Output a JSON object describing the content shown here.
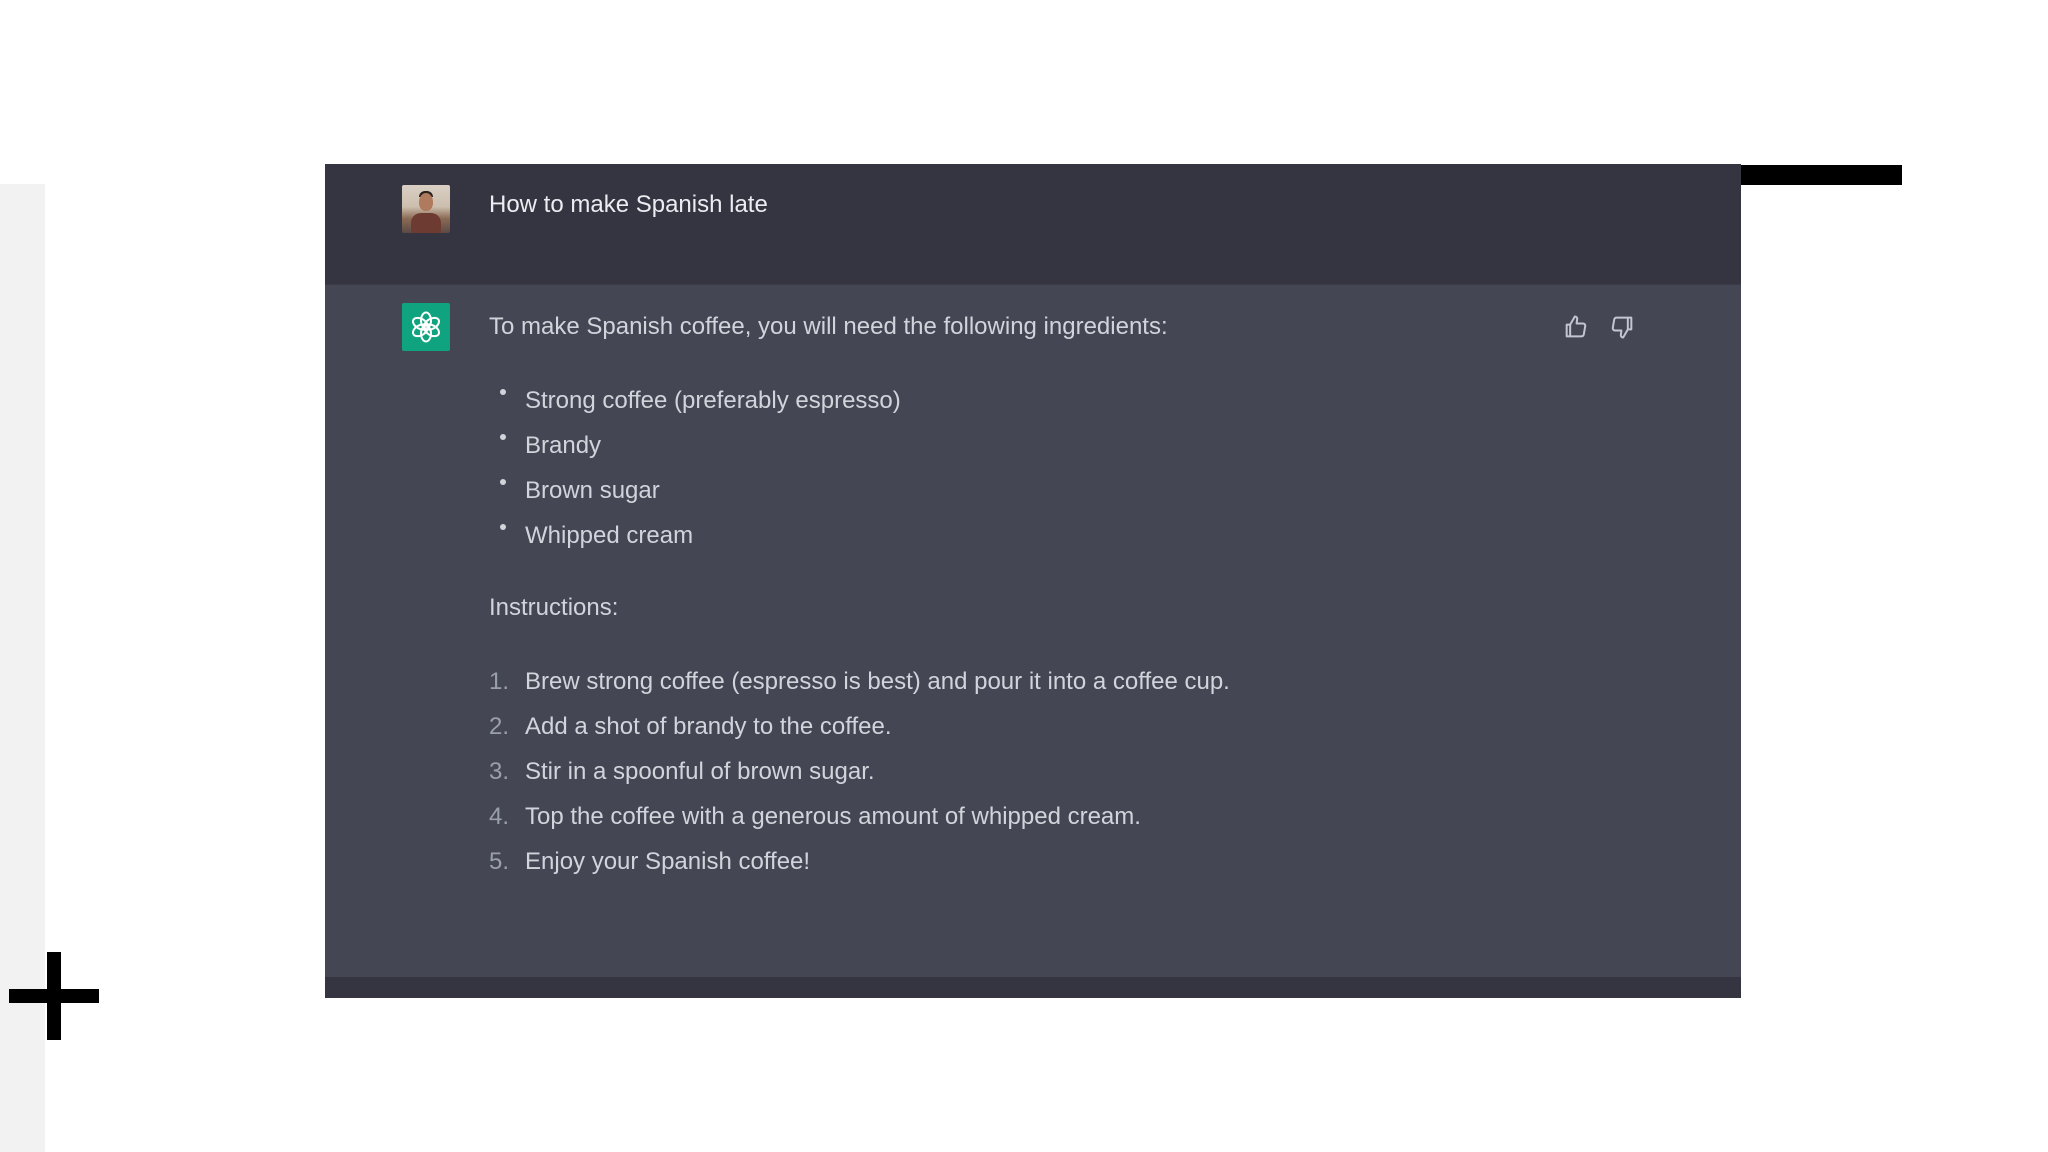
{
  "colors": {
    "page_background": "#ffffff",
    "user_row_background": "#343541",
    "assistant_row_background": "#444654",
    "assistant_avatar": "#10a37f",
    "text": "#d1d5db"
  },
  "conversation": {
    "user_message": "How to make Spanish late",
    "assistant": {
      "intro": "To make Spanish coffee, you will need the following ingredients:",
      "ingredients": [
        "Strong coffee (preferably espresso)",
        "Brandy",
        "Brown sugar",
        "Whipped cream"
      ],
      "instructions_label": "Instructions:",
      "steps": [
        {
          "number": "1.",
          "text": "Brew strong coffee (espresso is best) and pour it into a coffee cup."
        },
        {
          "number": "2.",
          "text": "Add a shot of brandy to the coffee."
        },
        {
          "number": "3.",
          "text": "Stir in a spoonful of brown sugar."
        },
        {
          "number": "4.",
          "text": "Top the coffee with a generous amount of whipped cream."
        },
        {
          "number": "5.",
          "text": "Enjoy your Spanish coffee!"
        }
      ]
    }
  },
  "icons": {
    "user_avatar": "user-avatar",
    "assistant_avatar": "openai-logo-icon",
    "like": "thumbs-up-icon",
    "dislike": "thumbs-down-icon",
    "add": "plus-icon"
  }
}
